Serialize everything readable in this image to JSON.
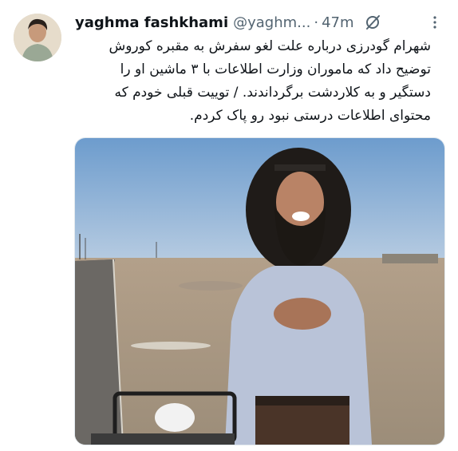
{
  "tweet": {
    "author": {
      "display_name": "yaghma fashkhami",
      "handle": "@yaghm...",
      "separator": "·",
      "time": "47m"
    },
    "text": "شهرام گودرزی درباره علت لغو سفرش به مقبره کوروش توضیح داد که ماموران وزارت اطلاعات با ۳ ماشین او را دستگیر و به کلاردشت برگرداندند. / توییت قبلی خودم که محتوای اطلاعات درستی نبود رو پاک کردم.",
    "icons": {
      "grok": "grok-icon",
      "more": "more-icon"
    },
    "colors": {
      "text": "#0f1419",
      "secondary": "#536471",
      "sky": "#6f9fd0"
    }
  }
}
